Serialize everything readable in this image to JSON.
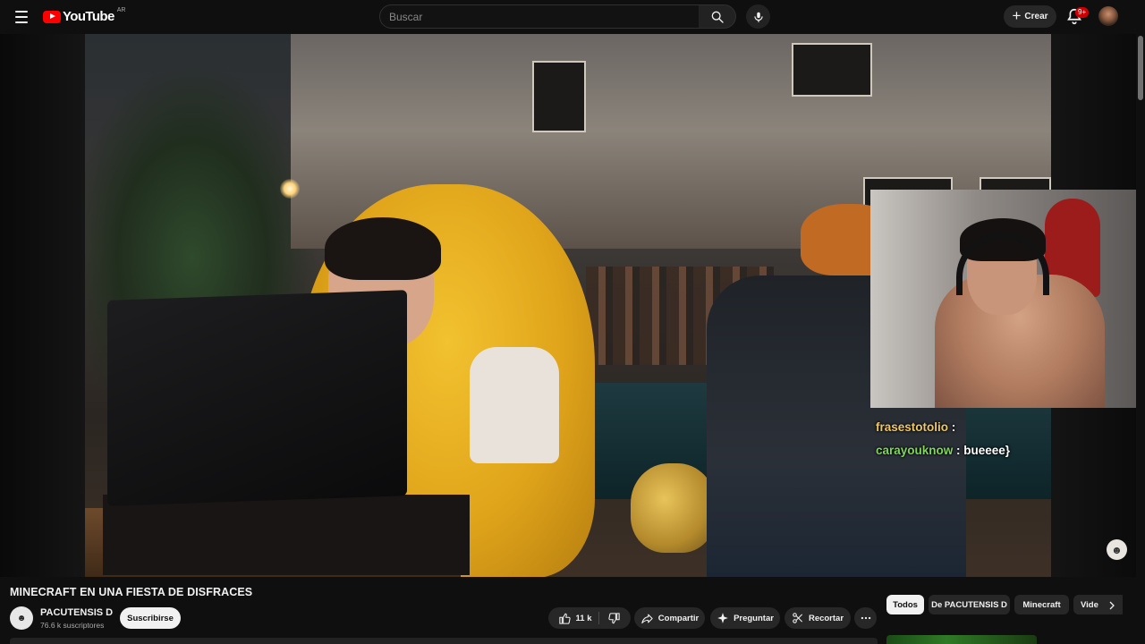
{
  "header": {
    "logo_text": "YouTube",
    "country_code": "AR",
    "search_placeholder": "Buscar",
    "create_label": "Crear",
    "notifications_badge": "9+"
  },
  "video": {
    "title": "MINECRAFT EN UNA FIESTA DE DISFRACES",
    "chat": [
      {
        "user": "frasestotolio",
        "message": "",
        "color": "#f0c860"
      },
      {
        "user": "carayouknow",
        "message": "bueeee}",
        "color": "#7fd65a"
      }
    ]
  },
  "channel": {
    "name": "PACUTENSIS D",
    "subscribers": "76.6 k suscriptores",
    "subscribe_label": "Suscribirse"
  },
  "actions": {
    "likes": "11 k",
    "share_label": "Compartir",
    "ask_label": "Preguntar",
    "clip_label": "Recortar"
  },
  "chips": [
    {
      "label": "Todos",
      "active": true
    },
    {
      "label": "De PACUTENSIS D",
      "active": false
    },
    {
      "label": "Minecraft",
      "active": false
    },
    {
      "label": "Vide",
      "active": false
    }
  ],
  "colors": {
    "background": "#0f0f0f",
    "brand_red": "#ff0000",
    "pill": "#272727",
    "badge": "#cc0000"
  }
}
